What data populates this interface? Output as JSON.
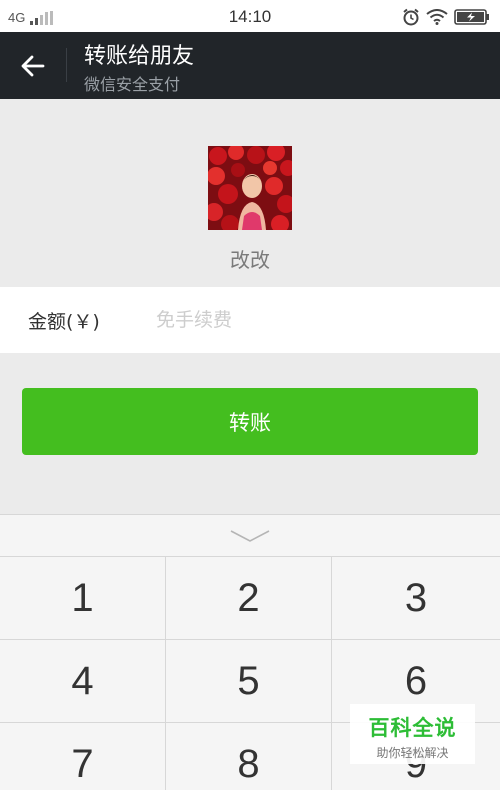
{
  "status_bar": {
    "network": "4G",
    "time": "14:10",
    "icons": [
      "signal-bars-icon",
      "alarm-clock-icon",
      "wifi-icon",
      "battery-charging-icon"
    ]
  },
  "header": {
    "back_icon": "arrow-left-icon",
    "title": "转账给朋友",
    "subtitle": "微信安全支付"
  },
  "recipient": {
    "name": "改改"
  },
  "amount": {
    "label": "金额(￥)",
    "value": "",
    "placeholder": "免手续费"
  },
  "transfer_button": {
    "label": "转账"
  },
  "keypad": {
    "collapse_icon": "chevron-down-icon",
    "keys": [
      "1",
      "2",
      "3",
      "4",
      "5",
      "6",
      "7",
      "8",
      "9"
    ]
  },
  "watermark": {
    "main": "百科全说",
    "sub": "助你轻松解决"
  },
  "colors": {
    "header_bg": "#212529",
    "accent_green": "#44be1f",
    "page_bg": "#ebebeb"
  }
}
